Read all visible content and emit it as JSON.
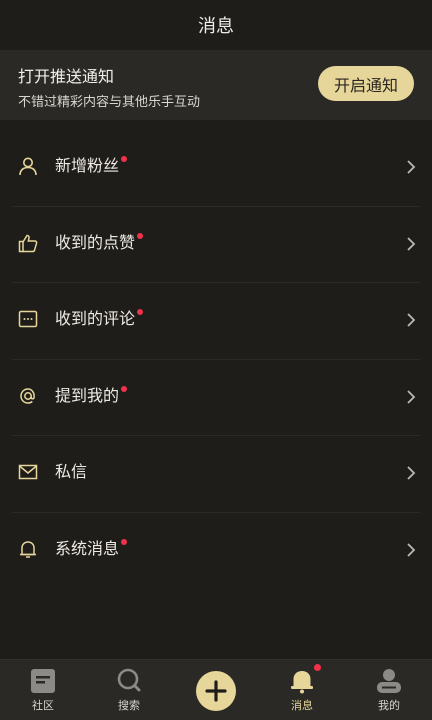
{
  "header": {
    "title": "消息"
  },
  "banner": {
    "title": "打开推送通知",
    "subtitle": "不错过精彩内容与其他乐手互动",
    "button_label": "开启通知"
  },
  "list": [
    {
      "label": "新增粉丝",
      "icon": "person-icon",
      "badge": true
    },
    {
      "label": "收到的点赞",
      "icon": "thumbs-up-icon",
      "badge": true
    },
    {
      "label": "收到的评论",
      "icon": "comment-icon",
      "badge": true
    },
    {
      "label": "提到我的",
      "icon": "at-icon",
      "badge": true
    },
    {
      "label": "私信",
      "icon": "envelope-icon",
      "badge": false
    },
    {
      "label": "系统消息",
      "icon": "bell-icon",
      "badge": true
    }
  ],
  "tabs": [
    {
      "label": "社区",
      "icon": "community-icon"
    },
    {
      "label": "搜索",
      "icon": "search-icon"
    },
    {
      "label": "",
      "icon": "plus-icon"
    },
    {
      "label": "消息",
      "icon": "bell-icon",
      "active": true,
      "badge": true
    },
    {
      "label": "我的",
      "icon": "profile-icon"
    }
  ],
  "colors": {
    "background": "#1f1d1a",
    "accent": "#e6d69a",
    "badge": "#f0324a"
  }
}
